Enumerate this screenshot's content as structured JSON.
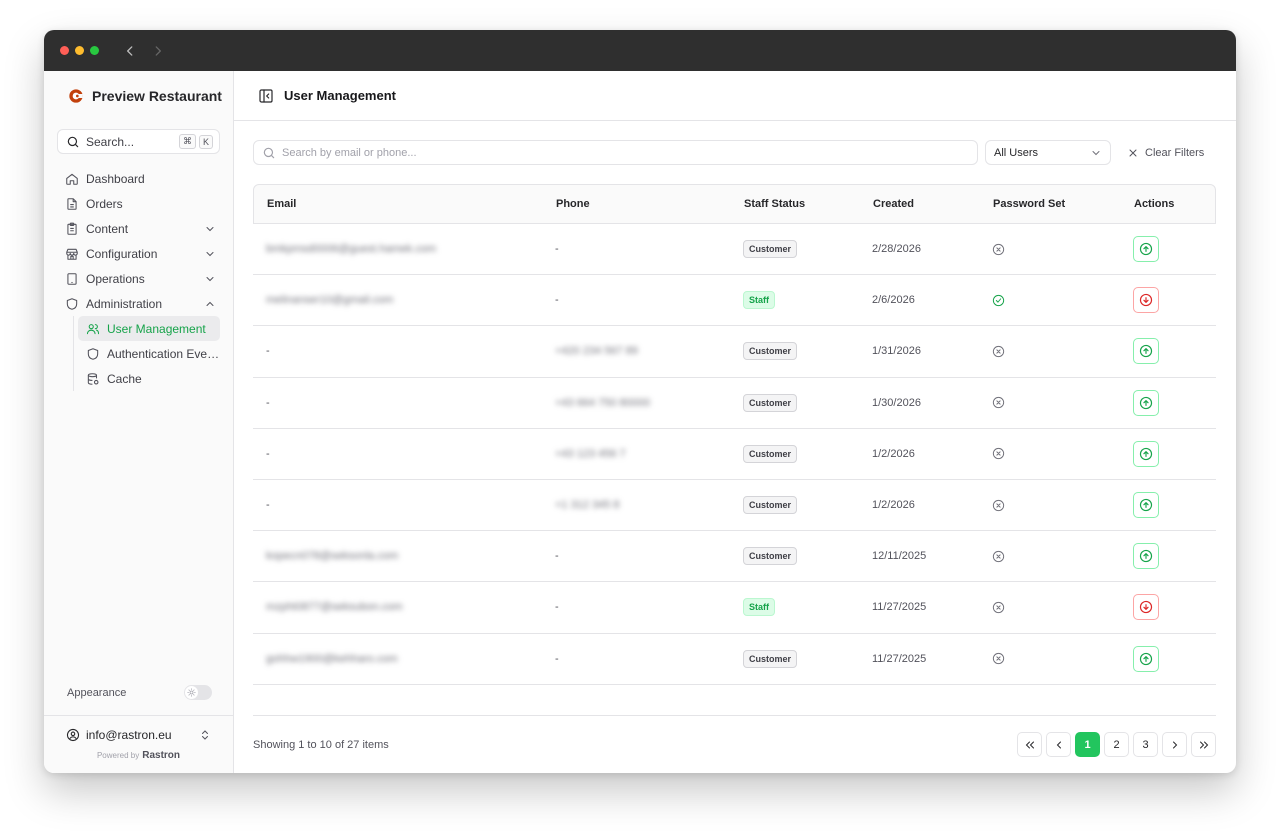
{
  "brand": {
    "name": "Preview Restaurant",
    "accent": "#22c55e"
  },
  "search": {
    "label": "Search...",
    "kbd_cmd": "⌘",
    "kbd_key": "K"
  },
  "sidebar": {
    "items": [
      {
        "label": "Dashboard",
        "icon": "home-icon"
      },
      {
        "label": "Orders",
        "icon": "file-icon"
      },
      {
        "label": "Content",
        "icon": "clipboard-icon"
      },
      {
        "label": "Configuration",
        "icon": "store-icon"
      },
      {
        "label": "Operations",
        "icon": "tablet-icon"
      },
      {
        "label": "Administration",
        "icon": "shield-icon"
      }
    ],
    "sub_items": [
      {
        "label": "User Management",
        "icon": "users-icon"
      },
      {
        "label": "Authentication Events",
        "icon": "shield-icon"
      },
      {
        "label": "Cache",
        "icon": "database-icon"
      }
    ],
    "appearance_label": "Appearance",
    "account_email": "info@rastron.eu",
    "powered_by": "Powered by",
    "powered_brand": "Rastron"
  },
  "header": {
    "title": "User Management"
  },
  "filters": {
    "search_placeholder": "Search by email or phone...",
    "select_value": "All Users",
    "clear_label": "Clear Filters"
  },
  "table": {
    "columns": [
      "Email",
      "Phone",
      "Staff Status",
      "Created",
      "Password Set",
      "Actions"
    ],
    "rows": [
      {
        "email": "bmkpmsd0006@guest.hamek.com",
        "phone": "-",
        "status": "Customer",
        "created": "2/28/2026",
        "password_set": false,
        "action": "promote"
      },
      {
        "email": "melinanser10@gmail.com",
        "phone": "-",
        "status": "Staff",
        "created": "2/6/2026",
        "password_set": true,
        "action": "demote"
      },
      {
        "email": "-",
        "phone": "+420 234 567 89",
        "status": "Customer",
        "created": "1/31/2026",
        "password_set": false,
        "action": "promote"
      },
      {
        "email": "-",
        "phone": "+43 664 750 80000",
        "status": "Customer",
        "created": "1/30/2026",
        "password_set": false,
        "action": "promote"
      },
      {
        "email": "-",
        "phone": "+43 123 456 7",
        "status": "Customer",
        "created": "1/2/2026",
        "password_set": false,
        "action": "promote"
      },
      {
        "email": "-",
        "phone": "+1 312 345 8",
        "status": "Customer",
        "created": "1/2/2026",
        "password_set": false,
        "action": "promote"
      },
      {
        "email": "kopecn078@seksonla.com",
        "phone": "-",
        "status": "Customer",
        "created": "12/11/2025",
        "password_set": false,
        "action": "promote"
      },
      {
        "email": "mzpht0877@seksubon.com",
        "phone": "-",
        "status": "Staff",
        "created": "11/27/2025",
        "password_set": false,
        "action": "demote"
      },
      {
        "email": "gohhw1900@kehharo.com",
        "phone": "-",
        "status": "Customer",
        "created": "11/27/2025",
        "password_set": false,
        "action": "promote"
      }
    ]
  },
  "pagination": {
    "summary": "Showing 1 to 10 of 27 items",
    "pages": [
      "1",
      "2",
      "3"
    ],
    "current": "1"
  }
}
